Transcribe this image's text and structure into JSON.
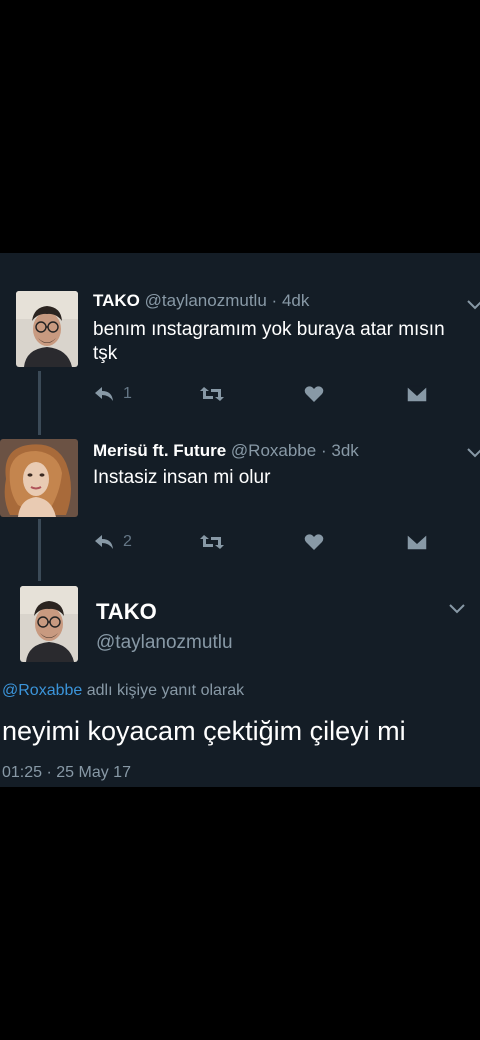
{
  "tweets": [
    {
      "name": "TAKO",
      "handle": "@taylanozmutlu",
      "separator": "·",
      "time": "4dk",
      "text": "benım ınstagramım yok buraya atar mısın\ntşk",
      "reply_count": "1",
      "avatar": "man-with-glasses-avatar"
    },
    {
      "name": "Merisü ft. Future",
      "handle": "@Roxabbe",
      "separator": "·",
      "time": "3dk",
      "text": "Instasiz insan mi olur",
      "reply_count": "2",
      "avatar": "woman-curly-hair-avatar"
    }
  ],
  "main_tweet": {
    "name": "TAKO",
    "handle": "@taylanozmutlu",
    "reply_to_mention": "@Roxabbe",
    "reply_to_suffix": " adlı kişiye yanıt olarak",
    "text": "neyimi koyacam çektiğim çileyi mi",
    "date": "01:25 · 25 May 17"
  },
  "icons": [
    "reply-icon",
    "retweet-icon",
    "like-icon",
    "direct-message-icon",
    "chevron-down-icon"
  ],
  "colors": {
    "background": "#141d26",
    "outer": "#000000",
    "secondary_text": "#8899a6",
    "mention": "#3b94d9",
    "icon": "#8899a6"
  }
}
